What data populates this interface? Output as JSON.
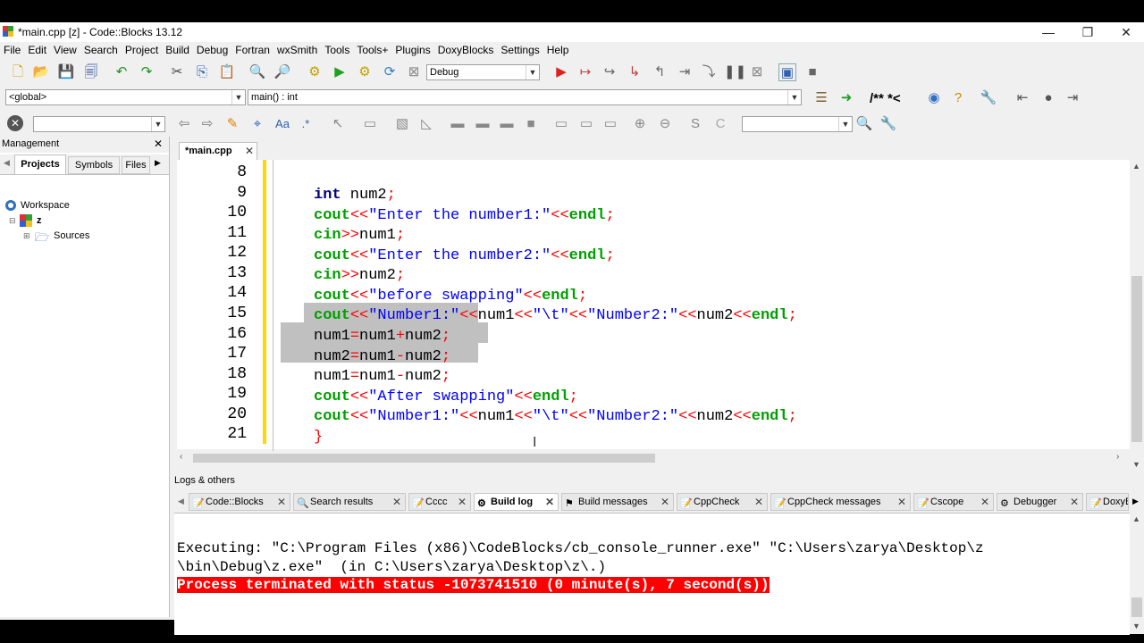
{
  "window": {
    "title": "*main.cpp [z] - Code::Blocks 13.12",
    "minimize": "—",
    "restore": "❐",
    "close": "✕"
  },
  "menu": [
    "File",
    "Edit",
    "View",
    "Search",
    "Project",
    "Build",
    "Debug",
    "Fortran",
    "wxSmith",
    "Tools",
    "Tools+",
    "Plugins",
    "DoxyBlocks",
    "Settings",
    "Help"
  ],
  "toolbar": {
    "build_target": "Debug",
    "scope_combo": "<global>",
    "function_combo": "main() : int",
    "doxy_comment": "/** *<"
  },
  "management": {
    "title": "Management",
    "close": "✕",
    "tabs": [
      "Projects",
      "Symbols",
      "Files"
    ],
    "tree": {
      "workspace": "Workspace",
      "project": "z",
      "folder": "Sources"
    }
  },
  "editor": {
    "tab_label": "*main.cpp",
    "tab_close": "✕",
    "line_numbers": [
      "8",
      "9",
      "10",
      "11",
      "12",
      "13",
      "14",
      "15",
      "16",
      "17",
      "18",
      "19",
      "20",
      "21"
    ]
  },
  "logs": {
    "title": "Logs & others",
    "tabs": [
      "Code::Blocks",
      "Search results",
      "Cccc",
      "Build log",
      "Build messages",
      "CppCheck",
      "CppCheck messages",
      "Cscope",
      "Debugger",
      "DoxyB"
    ],
    "active_tab": "Build log",
    "line1": "Executing: \"C:\\Program Files (x86)\\CodeBlocks/cb_console_runner.exe\" \"C:\\Users\\zarya\\Desktop\\z",
    "line2": "\\bin\\Debug\\z.exe\"  (in C:\\Users\\zarya\\Desktop\\z\\.)",
    "line3": "Process terminated with status -1073741510 (0 minute(s), 7 second(s))"
  },
  "colors": {
    "keyword_green": "#00a000",
    "string_blue": "#0000ff",
    "operator_red": "#ff0000",
    "selection_gray": "#c0c0c0",
    "error_red": "#ff0000",
    "change_bar_yellow": "#ffd800"
  }
}
